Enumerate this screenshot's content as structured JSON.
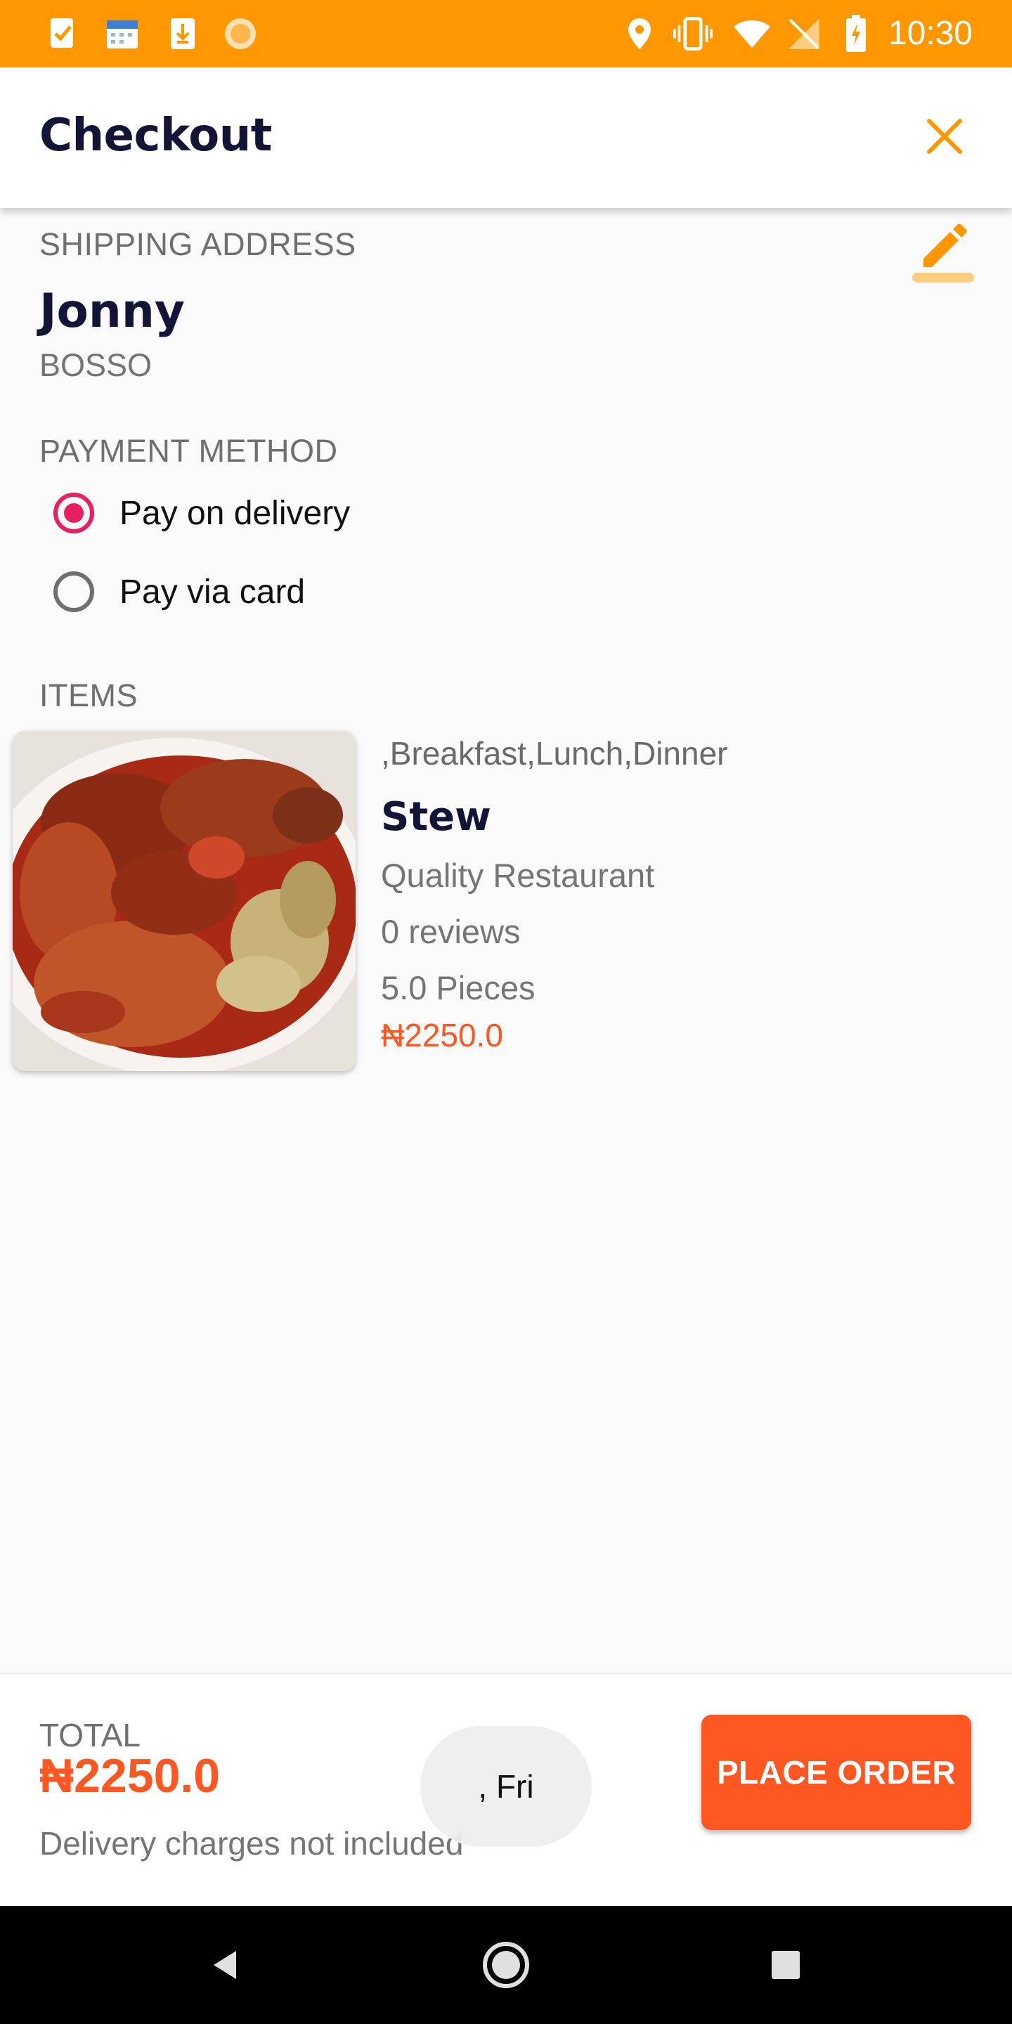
{
  "status_bar": {
    "time": "10:30",
    "icons": [
      "task-icon",
      "calendar-icon",
      "download-icon",
      "sun-icon",
      "location-icon",
      "vibrate-icon",
      "wifi-icon",
      "no-sim-icon",
      "battery-icon"
    ]
  },
  "app_bar": {
    "title": "Checkout",
    "close_icon": "close-icon"
  },
  "shipping": {
    "label": "SHIPPING ADDRESS",
    "name": "Jonny",
    "address": "BOSSO",
    "edit_icon": "pencil-icon"
  },
  "payment": {
    "label": "PAYMENT METHOD",
    "options": [
      {
        "label": "Pay on delivery",
        "selected": true
      },
      {
        "label": "Pay via card",
        "selected": false
      }
    ]
  },
  "items": {
    "label": "ITEMS",
    "list": [
      {
        "tags": ",Breakfast,Lunch,Dinner",
        "name": "Stew",
        "restaurant": "Quality Restaurant",
        "reviews": "0 reviews",
        "quantity": "5.0 Pieces",
        "price": "₦2250.0"
      }
    ]
  },
  "footer": {
    "total_label": "TOTAL",
    "total_value": "₦2250.0",
    "note": "Delivery charges not included",
    "button": "PLACE ORDER",
    "chip": ", Fri"
  },
  "colors": {
    "status_bar": "#ff9800",
    "accent": "#ff5722",
    "radio": "#e91e63",
    "title": "#131436"
  }
}
